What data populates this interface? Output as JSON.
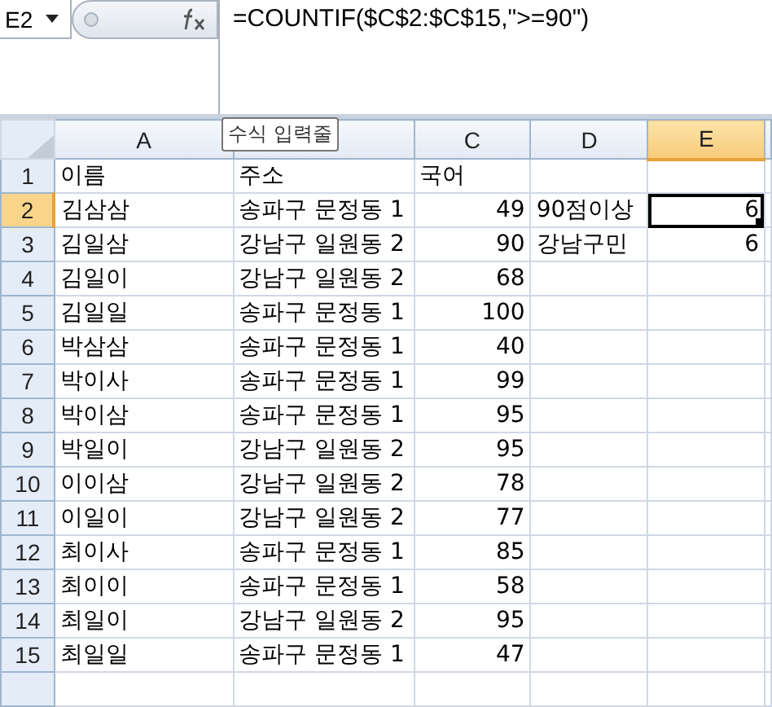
{
  "name_box": {
    "value": "E2"
  },
  "formula_bar": {
    "value": "=COUNTIF($C$2:$C$15,\">=90\")"
  },
  "tooltip": {
    "text": "수식 입력줄"
  },
  "columns": [
    {
      "label": "A",
      "selected": false
    },
    {
      "selected": false
    },
    {
      "label": "C",
      "selected": false
    },
    {
      "label": "D",
      "selected": false
    },
    {
      "label": "E",
      "selected": true
    }
  ],
  "rows": [
    {
      "number": "1",
      "selected": false,
      "cells": [
        {
          "text": "이름",
          "kind": "text"
        },
        {
          "text": "주소",
          "kind": "text"
        },
        {
          "text": "국어",
          "kind": "text"
        },
        {},
        {}
      ]
    },
    {
      "number": "2",
      "selected": true,
      "cells": [
        {
          "text": "김삼삼",
          "kind": "text"
        },
        {
          "text": "송파구 문정동 1",
          "kind": "text"
        },
        {
          "text": "49",
          "kind": "number"
        },
        {
          "text": "90점이상",
          "kind": "text"
        },
        {
          "text": "6",
          "kind": "number"
        }
      ]
    },
    {
      "number": "3",
      "selected": false,
      "cells": [
        {
          "text": "김일삼",
          "kind": "text"
        },
        {
          "text": "강남구 일원동 2",
          "kind": "text"
        },
        {
          "text": "90",
          "kind": "number"
        },
        {
          "text": "강남구민",
          "kind": "text"
        },
        {
          "text": "6",
          "kind": "number"
        }
      ]
    },
    {
      "number": "4",
      "selected": false,
      "cells": [
        {
          "text": "김일이",
          "kind": "text"
        },
        {
          "text": "강남구 일원동 2",
          "kind": "text"
        },
        {
          "text": "68",
          "kind": "number"
        },
        {},
        {}
      ]
    },
    {
      "number": "5",
      "selected": false,
      "cells": [
        {
          "text": "김일일",
          "kind": "text"
        },
        {
          "text": "송파구 문정동 1",
          "kind": "text"
        },
        {
          "text": "100",
          "kind": "number"
        },
        {},
        {}
      ]
    },
    {
      "number": "6",
      "selected": false,
      "cells": [
        {
          "text": "박삼삼",
          "kind": "text"
        },
        {
          "text": "송파구 문정동 1",
          "kind": "text"
        },
        {
          "text": "40",
          "kind": "number"
        },
        {},
        {}
      ]
    },
    {
      "number": "7",
      "selected": false,
      "cells": [
        {
          "text": "박이사",
          "kind": "text"
        },
        {
          "text": "송파구 문정동 1",
          "kind": "text"
        },
        {
          "text": "99",
          "kind": "number"
        },
        {},
        {}
      ]
    },
    {
      "number": "8",
      "selected": false,
      "cells": [
        {
          "text": "박이삼",
          "kind": "text"
        },
        {
          "text": "송파구 문정동 1",
          "kind": "text"
        },
        {
          "text": "95",
          "kind": "number"
        },
        {},
        {}
      ]
    },
    {
      "number": "9",
      "selected": false,
      "cells": [
        {
          "text": "박일이",
          "kind": "text"
        },
        {
          "text": "강남구 일원동 2",
          "kind": "text"
        },
        {
          "text": "95",
          "kind": "number"
        },
        {},
        {}
      ]
    },
    {
      "number": "10",
      "selected": false,
      "cells": [
        {
          "text": "이이삼",
          "kind": "text"
        },
        {
          "text": "강남구 일원동 2",
          "kind": "text"
        },
        {
          "text": "78",
          "kind": "number"
        },
        {},
        {}
      ]
    },
    {
      "number": "11",
      "selected": false,
      "cells": [
        {
          "text": "이일이",
          "kind": "text"
        },
        {
          "text": "강남구 일원동 2",
          "kind": "text"
        },
        {
          "text": "77",
          "kind": "number"
        },
        {},
        {}
      ]
    },
    {
      "number": "12",
      "selected": false,
      "cells": [
        {
          "text": "최이사",
          "kind": "text"
        },
        {
          "text": "송파구 문정동 1",
          "kind": "text"
        },
        {
          "text": "85",
          "kind": "number"
        },
        {},
        {}
      ]
    },
    {
      "number": "13",
      "selected": false,
      "cells": [
        {
          "text": "최이이",
          "kind": "text"
        },
        {
          "text": "송파구 문정동 1",
          "kind": "text"
        },
        {
          "text": "58",
          "kind": "number"
        },
        {},
        {}
      ]
    },
    {
      "number": "14",
      "selected": false,
      "cells": [
        {
          "text": "최일이",
          "kind": "text"
        },
        {
          "text": "강남구 일원동 2",
          "kind": "text"
        },
        {
          "text": "95",
          "kind": "number"
        },
        {},
        {}
      ]
    },
    {
      "number": "15",
      "selected": false,
      "cells": [
        {
          "text": "최일일",
          "kind": "text"
        },
        {
          "text": "송파구 문정동 1",
          "kind": "text"
        },
        {
          "text": "47",
          "kind": "number"
        },
        {},
        {}
      ]
    }
  ]
}
